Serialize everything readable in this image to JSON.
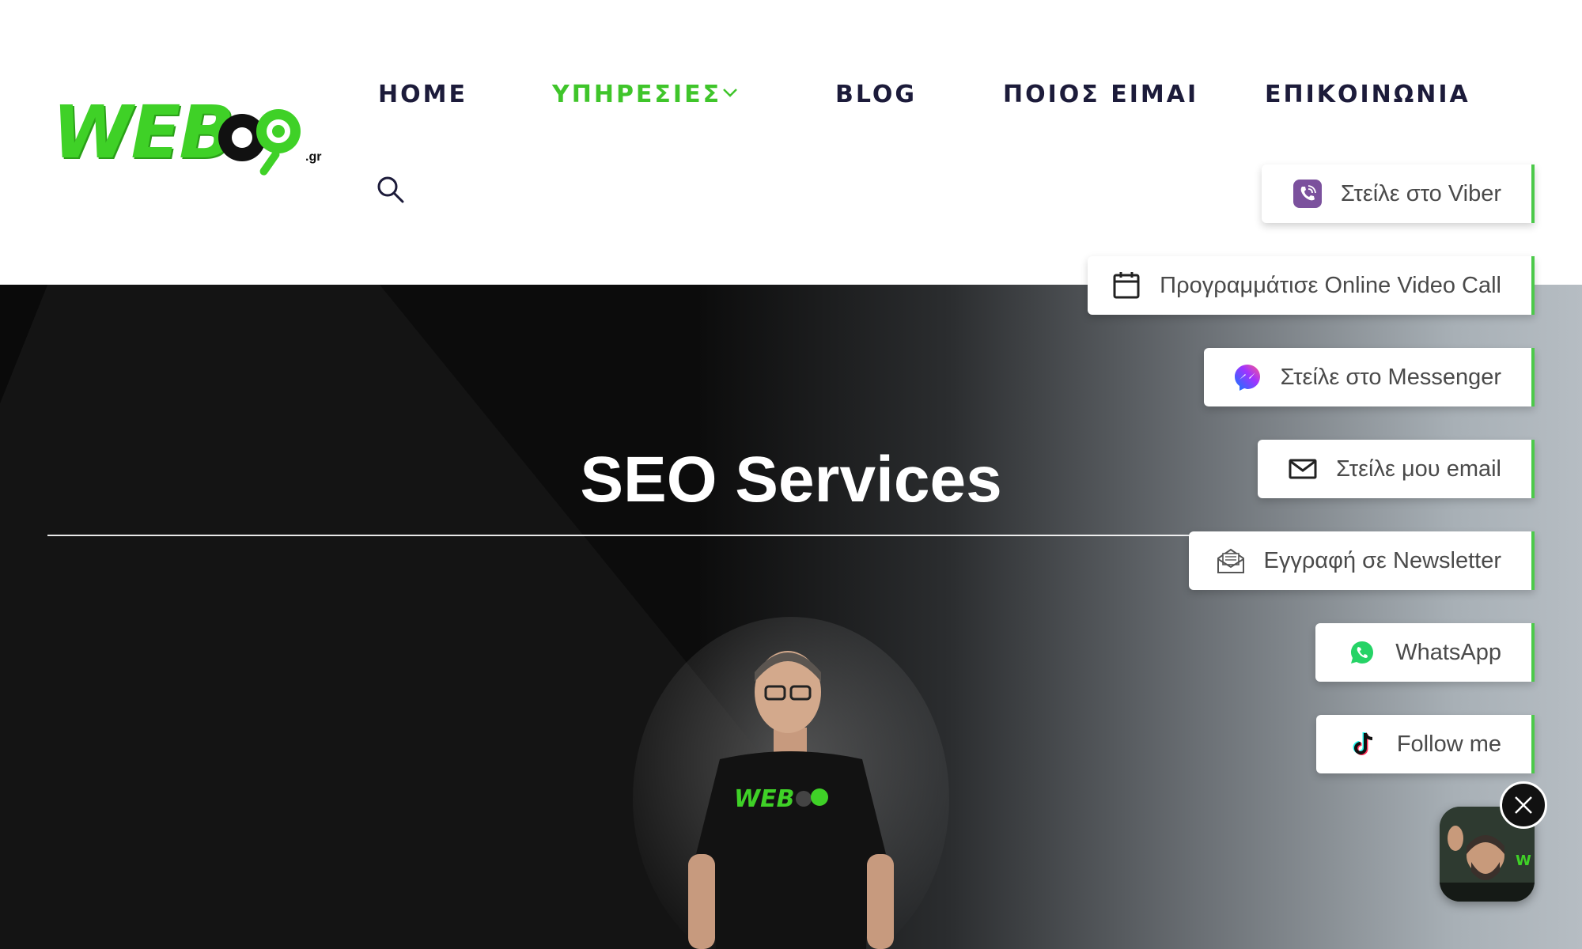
{
  "brand": {
    "logo_text": "WEB",
    "logo_tld": ".gr",
    "logo_color": "#3fd127"
  },
  "nav": {
    "home": "HOME",
    "services": "ΥΠΗΡΕΣΙΕΣ",
    "blog": "BLOG",
    "about": "ΠΟΙΟΣ ΕΙΜΑΙ",
    "contact": "ΕΠΙΚΟΙΝΩΝΙΑ",
    "active_color": "#3fc52a",
    "text_color": "#1c1b3a"
  },
  "hero": {
    "title": "SEO Services",
    "shirt_text": "WEB"
  },
  "contact_buttons": [
    {
      "label": "Στείλε στο Viber",
      "icon": "viber-icon"
    },
    {
      "label": "Προγραμμάτισε Online Video Call",
      "icon": "calendar-icon"
    },
    {
      "label": "Στείλε στο Messenger",
      "icon": "messenger-icon"
    },
    {
      "label": "Στείλε μου email",
      "icon": "email-icon"
    },
    {
      "label": "Εγγραφή σε Newsletter",
      "icon": "newsletter-icon"
    },
    {
      "label": "WhatsApp",
      "icon": "whatsapp-icon"
    },
    {
      "label": "Follow me",
      "icon": "tiktok-icon"
    }
  ],
  "accent": "#4cc94a"
}
